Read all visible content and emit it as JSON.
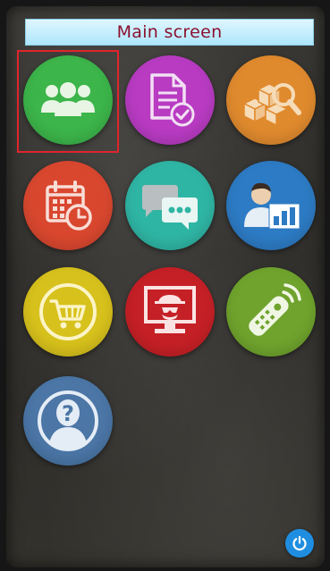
{
  "header": {
    "title": "Main screen"
  },
  "colors": {
    "title_text": "#8a1230",
    "title_bar": "#bdeafc",
    "selection_frame": "#e0242c",
    "power_button": "#1f8ee0"
  },
  "tiles": [
    {
      "icon": "users-group-icon",
      "color": "#3cb54a",
      "selected": true
    },
    {
      "icon": "document-check-icon",
      "color": "#b83bc2"
    },
    {
      "icon": "box-search-icon",
      "color": "#e08a2e"
    },
    {
      "icon": "calendar-clock-icon",
      "color": "#d9472f"
    },
    {
      "icon": "chat-bubbles-icon",
      "color": "#2fb5a4"
    },
    {
      "icon": "user-report-icon",
      "color": "#2d7bc4"
    },
    {
      "icon": "shopping-cart-icon",
      "color": "#d7c11c"
    },
    {
      "icon": "spy-monitor-icon",
      "color": "#c52026"
    },
    {
      "icon": "remote-control-icon",
      "color": "#6fa32d"
    },
    {
      "icon": "help-person-icon",
      "color": "#4b76a6"
    }
  ],
  "footer": {
    "power_icon": "power-icon"
  }
}
